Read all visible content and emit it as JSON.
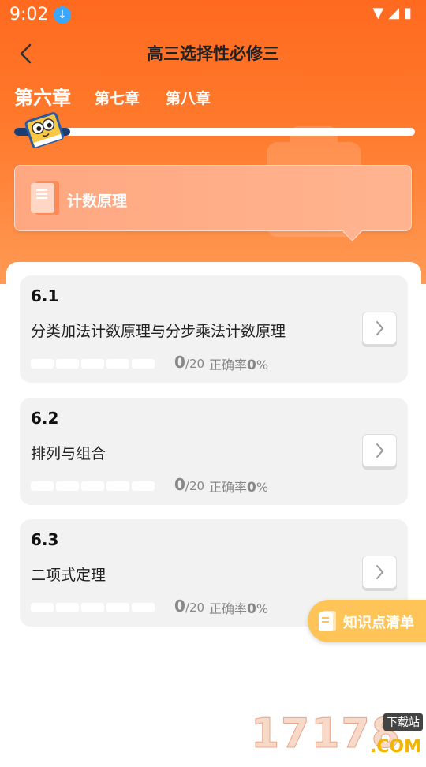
{
  "status_bar": {
    "time": "9:02"
  },
  "header": {
    "title": "高三选择性必修三"
  },
  "chapters": [
    {
      "label": "第六章",
      "active": true
    },
    {
      "label": "第七章",
      "active": false
    },
    {
      "label": "第八章",
      "active": false
    }
  ],
  "chapter_progress": 0.14,
  "section": {
    "label": "计数原理"
  },
  "lessons": [
    {
      "number": "6.1",
      "title": "分类加法计数原理与分步乘法计数原理",
      "score": "0",
      "total": "/20",
      "accuracy_label": "正确率",
      "accuracy_value": "0",
      "accuracy_unit": "%"
    },
    {
      "number": "6.2",
      "title": "排列与组合",
      "score": "0",
      "total": "/20",
      "accuracy_label": "正确率",
      "accuracy_value": "0",
      "accuracy_unit": "%"
    },
    {
      "number": "6.3",
      "title": "二项式定理",
      "score": "0",
      "total": "/20",
      "accuracy_label": "正确率",
      "accuracy_value": "0",
      "accuracy_unit": "%"
    }
  ],
  "knowledge_button": {
    "label": "知识点清单"
  },
  "watermark": {
    "number": "17178",
    "tag": "下载站",
    "suffix": ".COM"
  },
  "colors": {
    "accent": "#ff6a1f",
    "slider_fill": "#1d3d72",
    "button": "#ffc458"
  }
}
